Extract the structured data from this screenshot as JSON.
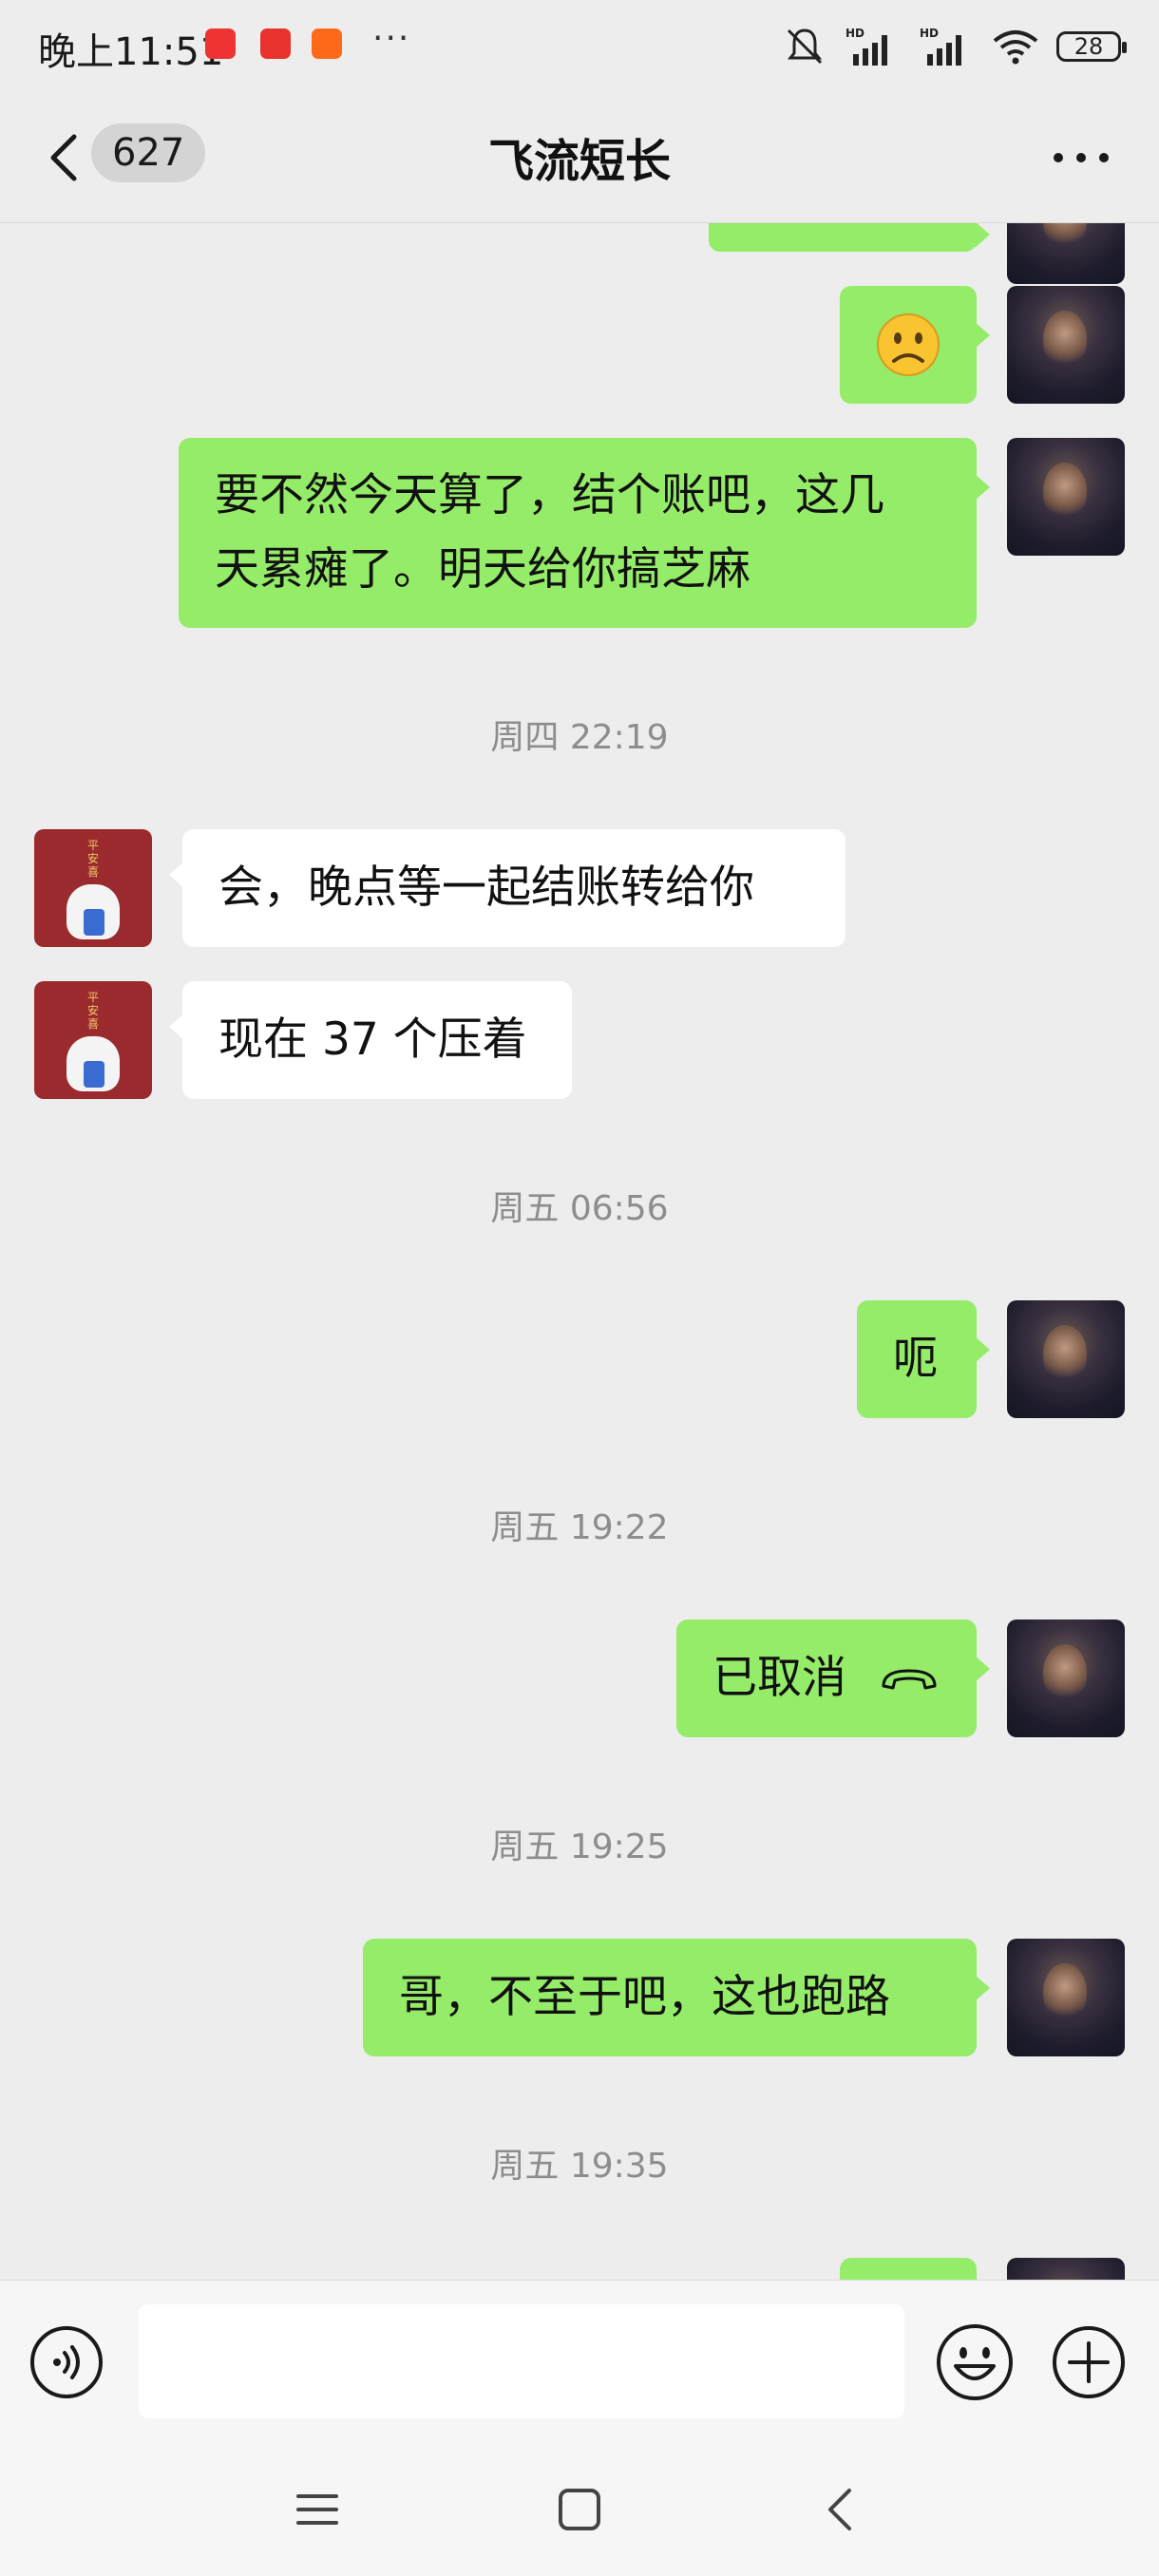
{
  "status_bar": {
    "time": "晚上11:51",
    "battery": "28",
    "overflow": "···"
  },
  "nav": {
    "unread_count": "627",
    "title": "飞流短长"
  },
  "messages": [
    {
      "type": "timestamp",
      "text": "周四 22:19"
    },
    {
      "type": "timestamp",
      "text": "周五 06:56"
    },
    {
      "type": "timestamp",
      "text": "周五 19:22"
    },
    {
      "type": "timestamp",
      "text": "周五 19:25"
    },
    {
      "type": "timestamp",
      "text": "周五 19:35"
    }
  ],
  "bubbles": {
    "me_long": "要不然今天算了，结个账吧，这几\n天累瘫了。明天给你搞芝麻",
    "them_1": "会，晚点等一起结账转给你",
    "them_2": "现在 37 个压着",
    "me_e": "呃",
    "me_call": "已取消",
    "me_run": "哥，不至于吧，这也跑路"
  },
  "icons": {
    "sad_emoji": "sad-face-emoji",
    "call": "phone-hangup-icon"
  },
  "colors": {
    "my_bubble": "#95ec69",
    "their_bubble": "#ffffff",
    "background": "#ededed"
  }
}
